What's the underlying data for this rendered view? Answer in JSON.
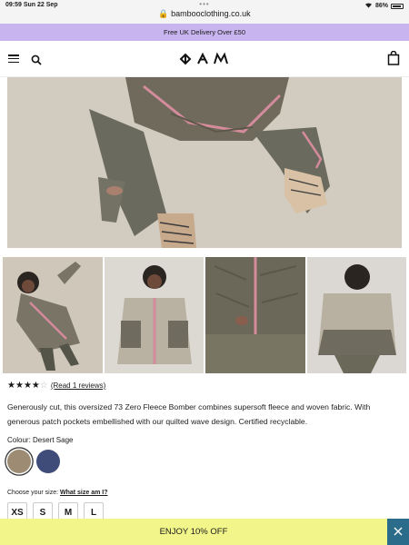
{
  "status_bar": {
    "time_date": "09:59  Sun 22 Sep",
    "dots": "•••",
    "url": "🔒 bambooclothing.co.uk",
    "battery": "86%"
  },
  "promo_banner": {
    "text": "Free UK Delivery Over £50"
  },
  "header": {
    "logo": "BAM"
  },
  "product": {
    "rating": {
      "value": 4,
      "max": 5,
      "reviews_link": "(Read 1 reviews)"
    },
    "description": "Generously cut, this oversized 73 Zero Fleece Bomber combines supersoft fleece and woven fabric. With generous patch pockets embellished with our quilted wave design. Certified recyclable.",
    "colour_label": "Colour: Desert Sage",
    "colours": [
      {
        "name": "Desert Sage",
        "hex": "#9d8c73",
        "selected": true
      },
      {
        "name": "Navy",
        "hex": "#3f4c7a",
        "selected": false
      }
    ],
    "size_prompt": "Choose your size:",
    "size_link": "What size am I?",
    "sizes": [
      "XS",
      "S",
      "M",
      "L"
    ]
  },
  "offer_bar": {
    "text": "ENJOY 10% OFF"
  },
  "colors": {
    "promo": "#c8b4ee",
    "offer": "#f2f58a",
    "close": "#2b6c8a"
  }
}
